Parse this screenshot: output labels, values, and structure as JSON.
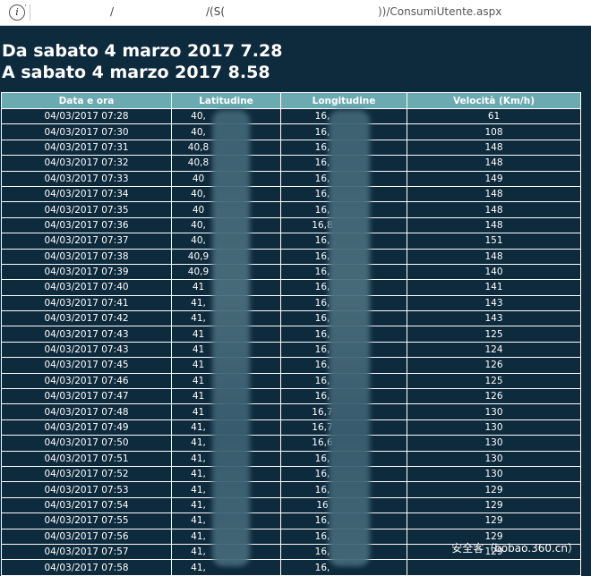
{
  "browser": {
    "url_part_1": "/",
    "url_part_2": "/(S(",
    "url_part_3": "))/ConsumiUtente.aspx",
    "info_icon": "info-circle-icon"
  },
  "report": {
    "title_from": "Da sabato 4 marzo 2017 7.28",
    "title_to": "A sabato 4 marzo 2017 8.58"
  },
  "table": {
    "headers": [
      "Data e ora",
      "Latitudine",
      "Longitudine",
      "Velocità (Km/h)"
    ],
    "rows": [
      {
        "datetime": "04/03/2017 07:28",
        "lat": "40,",
        "lon": "16,",
        "speed": "61"
      },
      {
        "datetime": "04/03/2017 07:30",
        "lat": "40,",
        "lon": "16,",
        "speed": "108"
      },
      {
        "datetime": "04/03/2017 07:31",
        "lat": "40,8",
        "lon": "16,",
        "speed": "148"
      },
      {
        "datetime": "04/03/2017 07:32",
        "lat": "40,8",
        "lon": "16,",
        "speed": "148"
      },
      {
        "datetime": "04/03/2017 07:33",
        "lat": "40",
        "lon": "16,",
        "speed": "149"
      },
      {
        "datetime": "04/03/2017 07:34",
        "lat": "40,",
        "lon": "16,",
        "speed": "148"
      },
      {
        "datetime": "04/03/2017 07:35",
        "lat": "40",
        "lon": "16,",
        "speed": "148"
      },
      {
        "datetime": "04/03/2017 07:36",
        "lat": "40,",
        "lon": "16,8",
        "speed": "148"
      },
      {
        "datetime": "04/03/2017 07:37",
        "lat": "40,",
        "lon": "16,",
        "speed": "151"
      },
      {
        "datetime": "04/03/2017 07:38",
        "lat": "40,9",
        "lon": "16,",
        "speed": "148"
      },
      {
        "datetime": "04/03/2017 07:39",
        "lat": "40,9",
        "lon": "16,",
        "speed": "140"
      },
      {
        "datetime": "04/03/2017 07:40",
        "lat": "41",
        "lon": "16,",
        "speed": "141"
      },
      {
        "datetime": "04/03/2017 07:41",
        "lat": "41,",
        "lon": "16,",
        "speed": "143"
      },
      {
        "datetime": "04/03/2017 07:42",
        "lat": "41,",
        "lon": "16,",
        "speed": "143"
      },
      {
        "datetime": "04/03/2017 07:43",
        "lat": "41",
        "lon": "16,",
        "speed": "125"
      },
      {
        "datetime": "04/03/2017 07:43",
        "lat": "41",
        "lon": "16,",
        "speed": "124"
      },
      {
        "datetime": "04/03/2017 07:45",
        "lat": "41",
        "lon": "16,",
        "speed": "126"
      },
      {
        "datetime": "04/03/2017 07:46",
        "lat": "41",
        "lon": "16,",
        "speed": "125"
      },
      {
        "datetime": "04/03/2017 07:47",
        "lat": "41",
        "lon": "16,",
        "speed": "126"
      },
      {
        "datetime": "04/03/2017 07:48",
        "lat": "41",
        "lon": "16,7",
        "speed": "130"
      },
      {
        "datetime": "04/03/2017 07:49",
        "lat": "41,",
        "lon": "16,7",
        "speed": "130"
      },
      {
        "datetime": "04/03/2017 07:50",
        "lat": "41,",
        "lon": "16,6",
        "speed": "130"
      },
      {
        "datetime": "04/03/2017 07:51",
        "lat": "41,",
        "lon": "16,",
        "speed": "130"
      },
      {
        "datetime": "04/03/2017 07:52",
        "lat": "41,",
        "lon": "16,",
        "speed": "130"
      },
      {
        "datetime": "04/03/2017 07:53",
        "lat": "41,",
        "lon": "16,",
        "speed": "129"
      },
      {
        "datetime": "04/03/2017 07:54",
        "lat": "41,",
        "lon": "16",
        "speed": "129"
      },
      {
        "datetime": "04/03/2017 07:55",
        "lat": "41,",
        "lon": "16,",
        "speed": "129"
      },
      {
        "datetime": "04/03/2017 07:56",
        "lat": "41,",
        "lon": "16,",
        "speed": "129"
      },
      {
        "datetime": "04/03/2017 07:57",
        "lat": "41,",
        "lon": "16,",
        "speed": "129"
      },
      {
        "datetime": "04/03/2017 07:58",
        "lat": "41,",
        "lon": "16,",
        "speed": ""
      }
    ]
  },
  "watermark": "安全客（bobao.360.cn）",
  "colors": {
    "page_background": "#0e2a3d",
    "header_background": "#6aaab0",
    "text": "#ffffff",
    "redaction": "#456a79"
  }
}
